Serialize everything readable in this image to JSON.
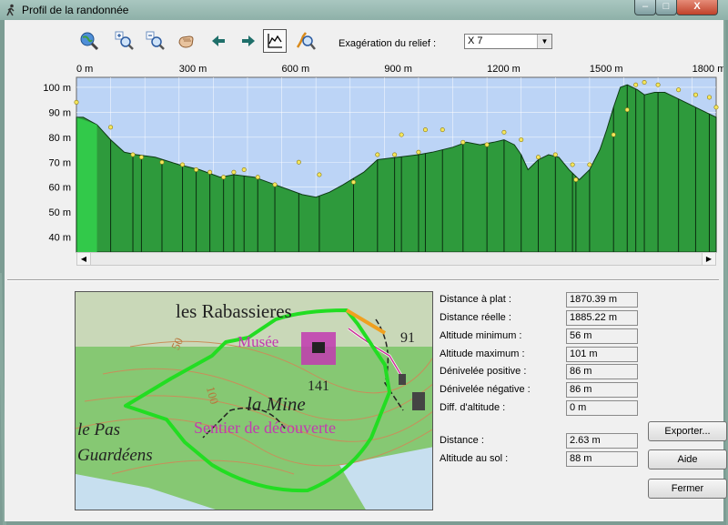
{
  "window": {
    "title": "Profil de la randonnée",
    "min_label": "–",
    "max_label": "□",
    "close_label": "X"
  },
  "toolbar": {
    "buttons": [
      {
        "name": "zoom-globe-button",
        "icon": "globe-zoom-icon"
      },
      {
        "name": "zoom-in-button",
        "icon": "zoom-in-icon"
      },
      {
        "name": "zoom-out-button",
        "icon": "zoom-out-icon"
      },
      {
        "name": "pan-button",
        "icon": "hand-icon"
      },
      {
        "name": "back-button",
        "icon": "arrow-left-icon"
      },
      {
        "name": "forward-button",
        "icon": "arrow-right-icon"
      },
      {
        "name": "profile-mode-button",
        "icon": "profile-chart-icon"
      },
      {
        "name": "route-search-button",
        "icon": "route-magnify-icon"
      }
    ],
    "relief_label": "Exagération du relief :",
    "relief_value": "X 7"
  },
  "chart_data": {
    "type": "area",
    "x_ticks": [
      "0 m",
      "300 m",
      "600 m",
      "900 m",
      "1200 m",
      "1500 m",
      "1800 m"
    ],
    "y_ticks": [
      "100 m",
      "90 m",
      "80 m",
      "70 m",
      "60 m",
      "50 m",
      "40 m"
    ],
    "x_range": [
      0,
      1870
    ],
    "y_range": [
      34,
      104
    ],
    "grid": true,
    "profile": [
      [
        0,
        88
      ],
      [
        20,
        88
      ],
      [
        60,
        85
      ],
      [
        100,
        79
      ],
      [
        140,
        74
      ],
      [
        175,
        73
      ],
      [
        230,
        72
      ],
      [
        300,
        69
      ],
      [
        360,
        67
      ],
      [
        420,
        64
      ],
      [
        460,
        65
      ],
      [
        520,
        64
      ],
      [
        560,
        62
      ],
      [
        620,
        59
      ],
      [
        660,
        57
      ],
      [
        700,
        56
      ],
      [
        740,
        58
      ],
      [
        780,
        61
      ],
      [
        840,
        66
      ],
      [
        880,
        71
      ],
      [
        940,
        72
      ],
      [
        1000,
        73
      ],
      [
        1040,
        74
      ],
      [
        1100,
        76
      ],
      [
        1140,
        78
      ],
      [
        1180,
        77
      ],
      [
        1220,
        78
      ],
      [
        1250,
        79
      ],
      [
        1280,
        77
      ],
      [
        1300,
        73
      ],
      [
        1320,
        67
      ],
      [
        1350,
        71
      ],
      [
        1380,
        73
      ],
      [
        1410,
        72
      ],
      [
        1440,
        67
      ],
      [
        1470,
        63
      ],
      [
        1500,
        67
      ],
      [
        1530,
        75
      ],
      [
        1550,
        83
      ],
      [
        1570,
        92
      ],
      [
        1590,
        100
      ],
      [
        1610,
        101
      ],
      [
        1640,
        99
      ],
      [
        1660,
        97
      ],
      [
        1690,
        98
      ],
      [
        1720,
        98
      ],
      [
        1750,
        96
      ],
      [
        1780,
        94
      ],
      [
        1810,
        92
      ],
      [
        1840,
        90
      ],
      [
        1870,
        88
      ]
    ],
    "points": [
      [
        0,
        94
      ],
      [
        100,
        84
      ],
      [
        165,
        73
      ],
      [
        190,
        72
      ],
      [
        250,
        70
      ],
      [
        310,
        69
      ],
      [
        350,
        67
      ],
      [
        390,
        66
      ],
      [
        430,
        64
      ],
      [
        460,
        66
      ],
      [
        490,
        67
      ],
      [
        530,
        64
      ],
      [
        580,
        61
      ],
      [
        650,
        70
      ],
      [
        710,
        65
      ],
      [
        810,
        62
      ],
      [
        880,
        73
      ],
      [
        930,
        73
      ],
      [
        950,
        81
      ],
      [
        1000,
        74
      ],
      [
        1020,
        83
      ],
      [
        1070,
        83
      ],
      [
        1130,
        78
      ],
      [
        1200,
        77
      ],
      [
        1250,
        82
      ],
      [
        1300,
        79
      ],
      [
        1350,
        72
      ],
      [
        1400,
        73
      ],
      [
        1450,
        69
      ],
      [
        1460,
        63
      ],
      [
        1500,
        69
      ],
      [
        1570,
        81
      ],
      [
        1610,
        91
      ],
      [
        1635,
        101
      ],
      [
        1660,
        102
      ],
      [
        1700,
        101
      ],
      [
        1760,
        99
      ],
      [
        1810,
        97
      ],
      [
        1850,
        96
      ],
      [
        1870,
        92
      ]
    ]
  },
  "map": {
    "labels": [
      "les Rabassieres",
      "Musée",
      "91",
      "50",
      "141",
      "100",
      "la Mine",
      "Sentier de découverte",
      "le Pas",
      "Guardéens"
    ]
  },
  "stats": [
    {
      "label": "Distance à plat :",
      "value": "1870.39 m"
    },
    {
      "label": "Distance réelle :",
      "value": "1885.22 m"
    },
    {
      "label": "Altitude minimum :",
      "value": "56 m"
    },
    {
      "label": "Altitude maximum :",
      "value": "101 m"
    },
    {
      "label": "Dénivelée positive :",
      "value": "86 m"
    },
    {
      "label": "Dénivelée négative :",
      "value": "86 m"
    },
    {
      "label": "Diff. d'altitude :",
      "value": "0 m"
    },
    {
      "label": "Distance :",
      "value": "2.63 m"
    },
    {
      "label": "Altitude au sol :",
      "value": "88 m"
    }
  ],
  "buttons": {
    "export": "Exporter...",
    "help": "Aide",
    "close": "Fermer"
  }
}
